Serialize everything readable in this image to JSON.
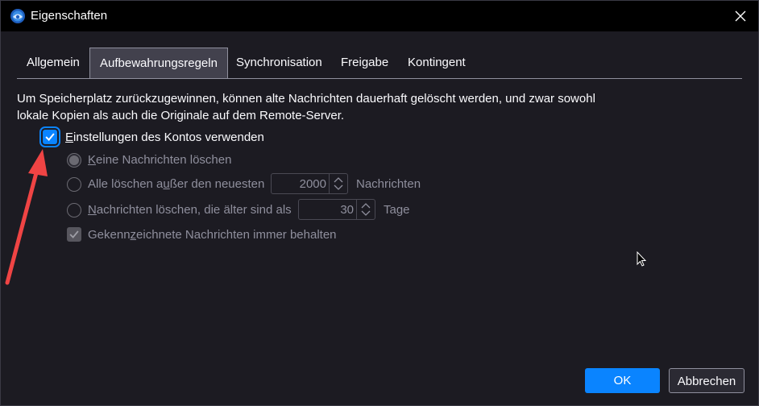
{
  "window": {
    "title": "Eigenschaften"
  },
  "tabs": [
    {
      "label": "Allgemein",
      "selected": false
    },
    {
      "label": "Aufbewahrungsregeln",
      "selected": true
    },
    {
      "label": "Synchronisation",
      "selected": false
    },
    {
      "label": "Freigabe",
      "selected": false
    },
    {
      "label": "Kontingent",
      "selected": false
    }
  ],
  "content": {
    "description_line1": "Um Speicherplatz zurückzugewinnen, können alte Nachrichten dauerhaft gelöscht werden, und zwar sowohl",
    "description_line2": "lokale Kopien als auch die Originale auf dem Remote-Server.",
    "use_account_settings": {
      "label_first": "E",
      "label_rest": "instellungen des Kontos verwenden",
      "checked": true
    },
    "keep_all": {
      "label_first": "K",
      "label_rest": "eine Nachrichten löschen",
      "selected": true,
      "enabled": false
    },
    "keep_newest": {
      "label_before": "Alle löschen a",
      "label_underlined": "u",
      "label_after": "ßer den neuesten",
      "value": "2000",
      "unit": "Nachrichten",
      "selected": false,
      "enabled": false
    },
    "delete_older": {
      "label_first": "N",
      "label_rest": "achrichten löschen, die älter sind als",
      "value": "30",
      "unit": "Tage",
      "selected": false,
      "enabled": false
    },
    "keep_flagged": {
      "label_before": "Gekenn",
      "label_underlined": "z",
      "label_after": "eichnete Nachrichten immer behalten",
      "checked": true,
      "enabled": false
    }
  },
  "buttons": {
    "ok": "OK",
    "cancel": "Abbrechen"
  },
  "colors": {
    "accent": "#0a84ff",
    "annotation_arrow": "#ef4444",
    "background": "#1c1b22",
    "titlebar": "#000000"
  }
}
